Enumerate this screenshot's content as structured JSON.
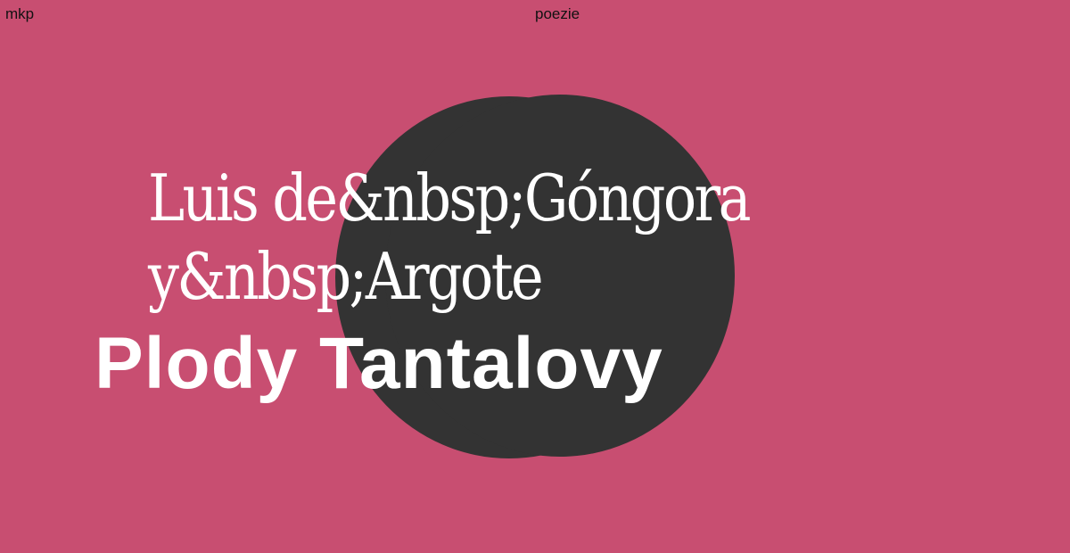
{
  "header": {
    "site_label": "mkp",
    "section_label": "poezie"
  },
  "cover": {
    "author_line_1": "Luis de&nbsp;Góngora",
    "author_line_2": "y&nbsp;Argote",
    "title": "Plody Tantalovy"
  },
  "colors": {
    "background": "#c84e71",
    "blob": "#333333",
    "text": "#ffffff"
  }
}
